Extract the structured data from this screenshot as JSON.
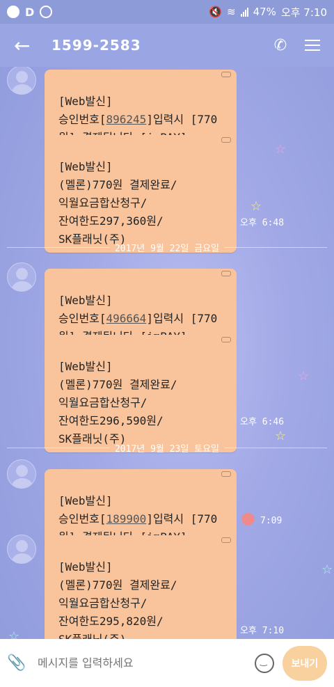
{
  "status_bar": {
    "left_icon_label": "D",
    "battery": "47%",
    "time": "오후 7:10"
  },
  "header": {
    "back_icon": "arrow-left-icon",
    "title": "1599-2583",
    "call_icon": "phone-lite-icon",
    "menu_icon": "menu-icon"
  },
  "messages": [
    {
      "lines": [
        "[Web발신]",
        "승인번호[",
        "896245",
        "]입력시 [770",
        "원] 결제됩니다.[imPAY]"
      ]
    },
    {
      "text": "[Web발신]\n(멜론)770원 결제완료/\n익월요금합산청구/\n잔여한도297,360원/\nSK플래닛(주)",
      "time": "오후 6:48"
    },
    {
      "date": "2017년 9월 22일 금요일"
    },
    {
      "lines": [
        "[Web발신]",
        "승인번호[",
        "496664",
        "]입력시 [770",
        "원] 결제됩니다.[imPAY]"
      ]
    },
    {
      "text": "[Web발신]\n(멜론)770원 결제완료/\n익월요금합산청구/\n잔여한도296,590원/\nSK플래닛(주)",
      "time": "오후 6:46"
    },
    {
      "date": "2017년 9월 23일 토요일"
    },
    {
      "lines": [
        "[Web발신]",
        "승인번호[",
        "189900",
        "]입력시 [770",
        "원] 결제됩니다.[imPAY]"
      ],
      "time": "7:09"
    },
    {
      "text": "[Web발신]\n(멜론)770원 결제완료/\n익월요금합산청구/\n잔여한도295,820원/\nSK플래닛(주)",
      "time": "오후 7:10"
    }
  ],
  "input": {
    "placeholder": "메시지를 입력하세요",
    "send_label": "보내기"
  },
  "colors": {
    "bubble": "#f9c49b",
    "header": "#9aa6e3",
    "send": "#f9d19e"
  }
}
